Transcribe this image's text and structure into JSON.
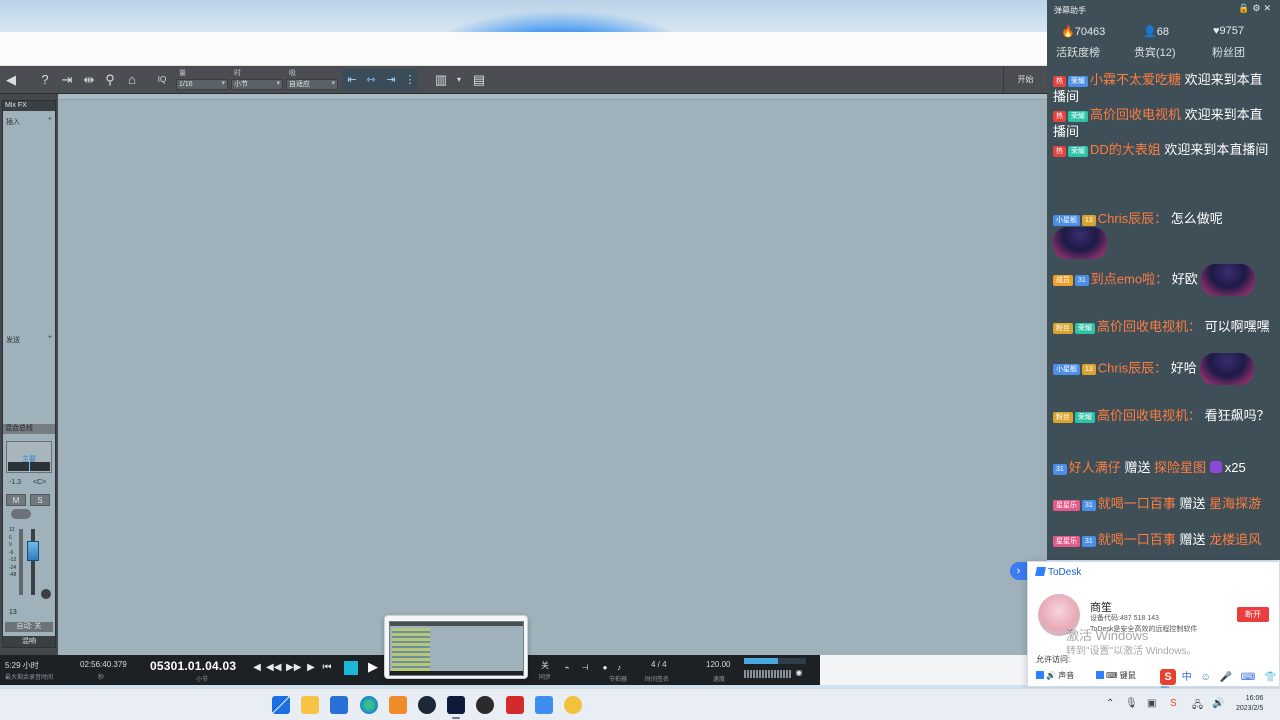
{
  "daw": {
    "toolbar": {
      "quantize_label": "量化",
      "quantize_value": "1/16",
      "timebase_label": "时基",
      "timebase_value": "小节",
      "snap_label": "吸附",
      "snap_value": "自适应",
      "iq_label": "IQ",
      "right_label": "开始"
    },
    "mix": {
      "header": "Mix FX",
      "insert_label": "插入",
      "send_label": "发送",
      "strip_label": "混合总线",
      "main_label": "主要",
      "vol_value": "-1.3",
      "pan_value": "<C>",
      "mute": "M",
      "solo": "S",
      "fader_scale": [
        "12",
        "6",
        "0",
        "-6",
        "-12",
        "-24",
        "-48"
      ],
      "num": "13",
      "auto_label": "自动: 关",
      "name": "混响"
    },
    "transport": {
      "record_time": "5:29 小时",
      "record_sub": "最大剩余录音时间",
      "time": "02:56:40.379",
      "time_sub": "秒",
      "position": "05301.01.04.03",
      "position_sub": "小节",
      "loop_label": "关",
      "loop_sub": "同步",
      "metronome_sub": "节拍器",
      "signature": "4 / 4",
      "signature_sub": "时间签名",
      "tempo": "120.00",
      "tempo_sub": "速度"
    }
  },
  "chat": {
    "title": "弹幕助手",
    "stats": {
      "popularity": "70463",
      "members": "68",
      "likes": "9757"
    },
    "tabs": {
      "activity": "活跃度榜",
      "vip": "贵宾(12)",
      "fans": "粉丝团"
    },
    "messages": [
      {
        "badges": [
          "热",
          "荣耀"
        ],
        "nick": "小霖不太爱吃糖",
        "text": "欢迎来到本直播间"
      },
      {
        "badges": [
          "热",
          "荣耀"
        ],
        "nick": "高价回收电视机",
        "text": "欢迎来到本直播间"
      },
      {
        "badges": [
          "热",
          "荣耀"
        ],
        "nick": "DD的大表姐",
        "text": "欢迎来到本直播间"
      },
      {
        "badges": [
          "小星舰",
          "13"
        ],
        "nick": "Chris辰辰：",
        "text": "怎么做呢"
      },
      {
        "badges": [
          "成员",
          "31"
        ],
        "nick": "到点emo啦：",
        "text": "好欧"
      },
      {
        "badges": [
          "粉丝",
          "荣耀"
        ],
        "nick": "高价回收电视机：",
        "text": "可以啊嘿嘿"
      },
      {
        "badges": [
          "小星舰",
          "13"
        ],
        "nick": "Chris辰辰：",
        "text": "好哈"
      },
      {
        "badges": [
          "粉丝",
          "荣耀"
        ],
        "nick": "高价回收电视机：",
        "text": "看狂飙吗？"
      },
      {
        "badges": [
          "31"
        ],
        "nick": "好人满仔",
        "text": "赠送",
        "gift": "探险星图",
        "count": "x25"
      },
      {
        "badges": [
          "星星乐",
          "31"
        ],
        "nick": "就喝一口百事",
        "text": "赠送",
        "gift": "星海探游"
      },
      {
        "badges": [
          "星星乐",
          "31"
        ],
        "nick": "就喝一口百事",
        "text": "赠送",
        "gift": "龙楼追风"
      }
    ]
  },
  "todesk": {
    "brand": "ToDesk",
    "user": "商笙",
    "device_code": "设备代码:487 518 143",
    "desc": "ToDesk是安全高效的远程控制软件",
    "disconnect": "断开",
    "allow_label": "允许访问:",
    "options": [
      "声音",
      "键鼠"
    ]
  },
  "watermark": {
    "line1": "激活 Windows",
    "line2": "转到\"设置\"以激活 Windows。"
  },
  "taskbar": {
    "time": "16:06",
    "date": "2023/2/5"
  },
  "colors": {
    "accent": "#1ab8d6",
    "chat_bg": "#3f4f58",
    "nick": "#ff7d3f",
    "todesk_blue": "#2e80ff",
    "disconnect_red": "#ea3d3d"
  }
}
